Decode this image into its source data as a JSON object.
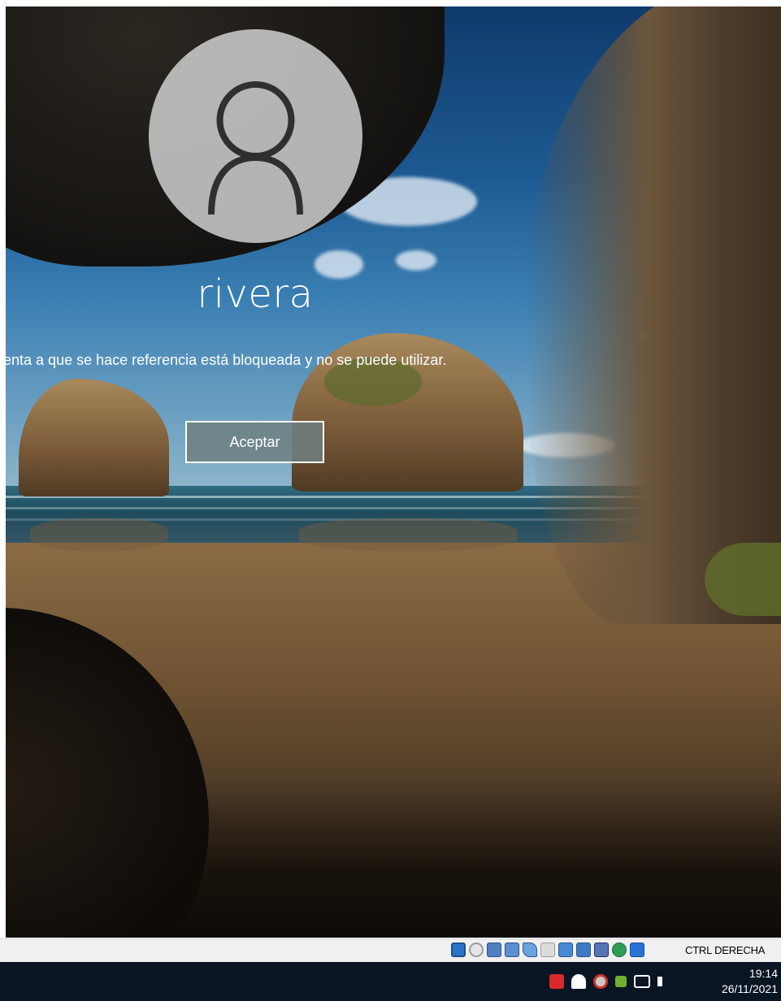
{
  "lock_screen": {
    "username": "rivera",
    "message": "cuenta a que se hace referencia está bloqueada y no se puede utilizar.",
    "ok_button_label": "Aceptar",
    "avatar_icon": "user-silhouette-icon"
  },
  "vm_statusbar": {
    "icons": [
      "hard-disk-icon",
      "optical-drive-icon",
      "audio-icon",
      "network-icon",
      "usb-icon",
      "shared-folders-icon",
      "display-icon",
      "video-capture-icon",
      "virtualization-icon",
      "mouse-integration-icon",
      "keyboard-capture-icon"
    ],
    "host_key_label": "CTRL DERECHA"
  },
  "taskbar": {
    "tray_icons": [
      "acrobat-icon",
      "security-shield-icon",
      "defender-alert-icon",
      "nvidia-icon",
      "network-icon",
      "volume-icon"
    ],
    "time": "19:14",
    "date": "26/11/2021"
  },
  "colors": {
    "taskbar_bg": "#0a1524",
    "statusbar_bg": "#f0f0f0",
    "button_bg": "#6e8080",
    "text": "#ffffff"
  }
}
